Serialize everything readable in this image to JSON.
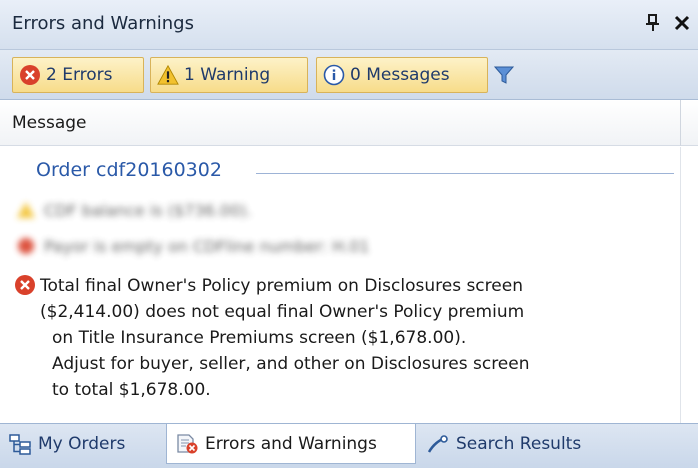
{
  "panel": {
    "title": "Errors and Warnings"
  },
  "toolbar": {
    "errors_label": "2 Errors",
    "warnings_label": "1 Warning",
    "messages_label": "0 Messages"
  },
  "grid": {
    "column_header": "Message"
  },
  "messages": {
    "group_title": "Order cdf20160302",
    "blurred_warning": "CDF balance is ($736.00).",
    "blurred_error": "Payor is empty on CDFline number: H.01",
    "error_lines": [
      "Total final Owner's Policy premium on Disclosures screen",
      "($2,414.00) does not equal final Owner's Policy premium",
      "on Title Insurance Premiums screen ($1,678.00).",
      "Adjust for buyer, seller, and other on Disclosures screen",
      "to total $1,678.00."
    ]
  },
  "tabs": {
    "my_orders": "My Orders",
    "errors_and_warnings": "Errors and Warnings",
    "search_results": "Search Results"
  },
  "colors": {
    "accent": "#2a59a8",
    "error_red": "#d9412b",
    "warning_yellow": "#f2c12e",
    "button_gold": "#f7dc8a"
  }
}
